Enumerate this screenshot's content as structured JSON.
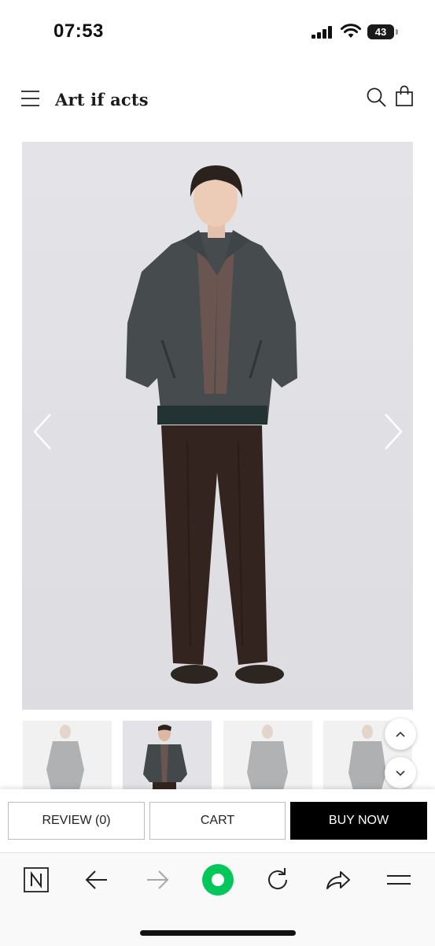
{
  "status_bar": {
    "time": "07:53",
    "battery_level": "43"
  },
  "header": {
    "brand": "Art if acts",
    "menu_icon": "hamburger-icon",
    "search_icon": "search-icon",
    "bag_icon": "shopping-bag-icon"
  },
  "product_gallery": {
    "image_description_icon": "product-photo",
    "prev_icon": "chevron-left-icon",
    "next_icon": "chevron-right-icon",
    "thumbnail_count": 4,
    "active_thumbnail": 2
  },
  "scroll_controls": {
    "up_icon": "chevron-up-icon",
    "down_icon": "chevron-down-icon"
  },
  "actions": {
    "review_label": "REVIEW (0)",
    "cart_label": "CART",
    "buy_now_label": "BUY NOW"
  },
  "browser_toolbar": {
    "icons": [
      "naver-n-icon",
      "back-arrow-icon",
      "forward-arrow-icon",
      "green-dot-icon",
      "refresh-icon",
      "share-icon",
      "menu-lines-icon"
    ],
    "accent_color": "#03c75a"
  }
}
